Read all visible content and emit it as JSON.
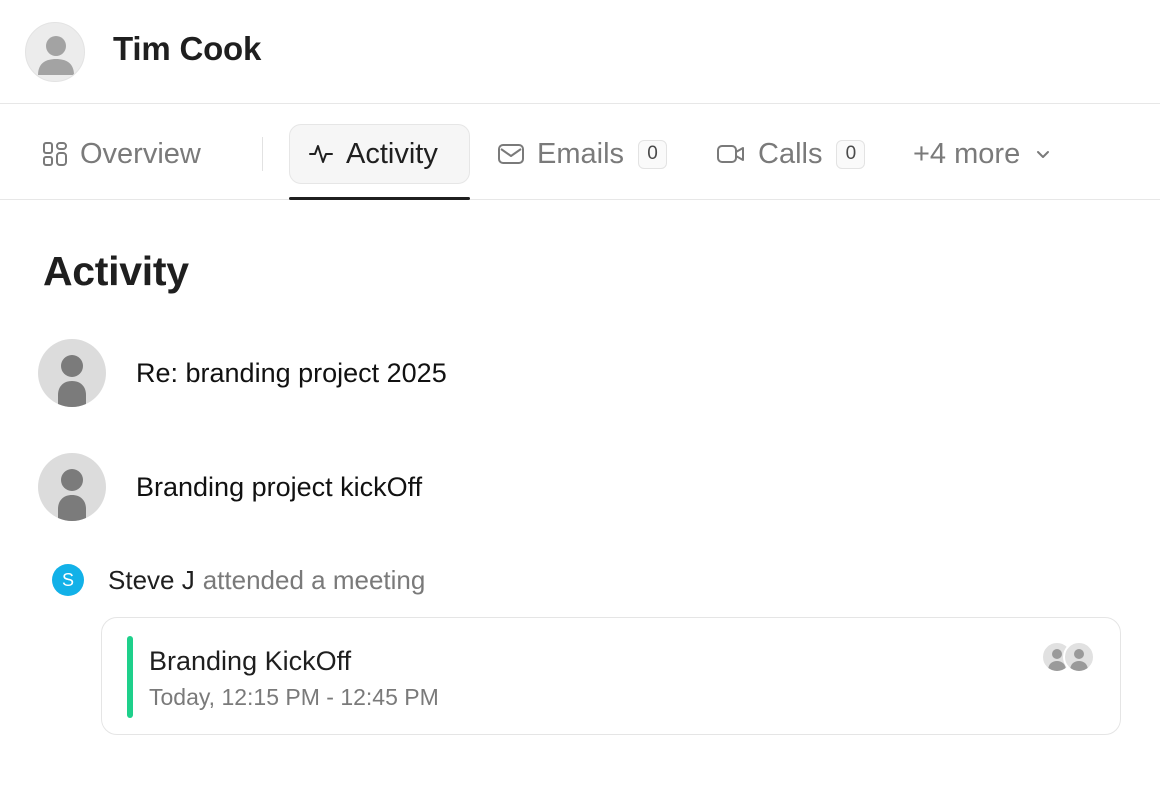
{
  "header": {
    "name": "Tim Cook",
    "avatar_icon": "person-icon"
  },
  "tabs": [
    {
      "label": "Overview",
      "icon": "grid-icon",
      "active": false
    },
    {
      "label": "Activity",
      "icon": "activity-pulse-icon",
      "active": true
    },
    {
      "label": "Emails",
      "icon": "envelope-icon",
      "count": "0",
      "active": false
    },
    {
      "label": "Calls",
      "icon": "video-camera-icon",
      "count": "0",
      "active": false
    },
    {
      "label": "+4 more",
      "icon": "chevron-down-icon",
      "active": false
    }
  ],
  "main": {
    "section_title": "Activity",
    "items": [
      {
        "title": "Re: branding project 2025",
        "avatar_icon": "person-icon"
      },
      {
        "title": "Branding project kickOff",
        "avatar_icon": "person-icon"
      }
    ],
    "meeting": {
      "actor_initial": "S",
      "actor": "Steve J",
      "action": "attended a meeting",
      "title": "Branding KickOff",
      "time": "Today, 12:15 PM - 12:45 PM",
      "accent_color": "#1ed08b",
      "attendee_icons": [
        "person-icon",
        "person-icon"
      ]
    }
  },
  "colors": {
    "badge_blue": "#12b1e8",
    "active_tab_bg": "#f6f6f6",
    "text_primary": "#1f1f1f",
    "text_muted": "#7a7a7a"
  }
}
